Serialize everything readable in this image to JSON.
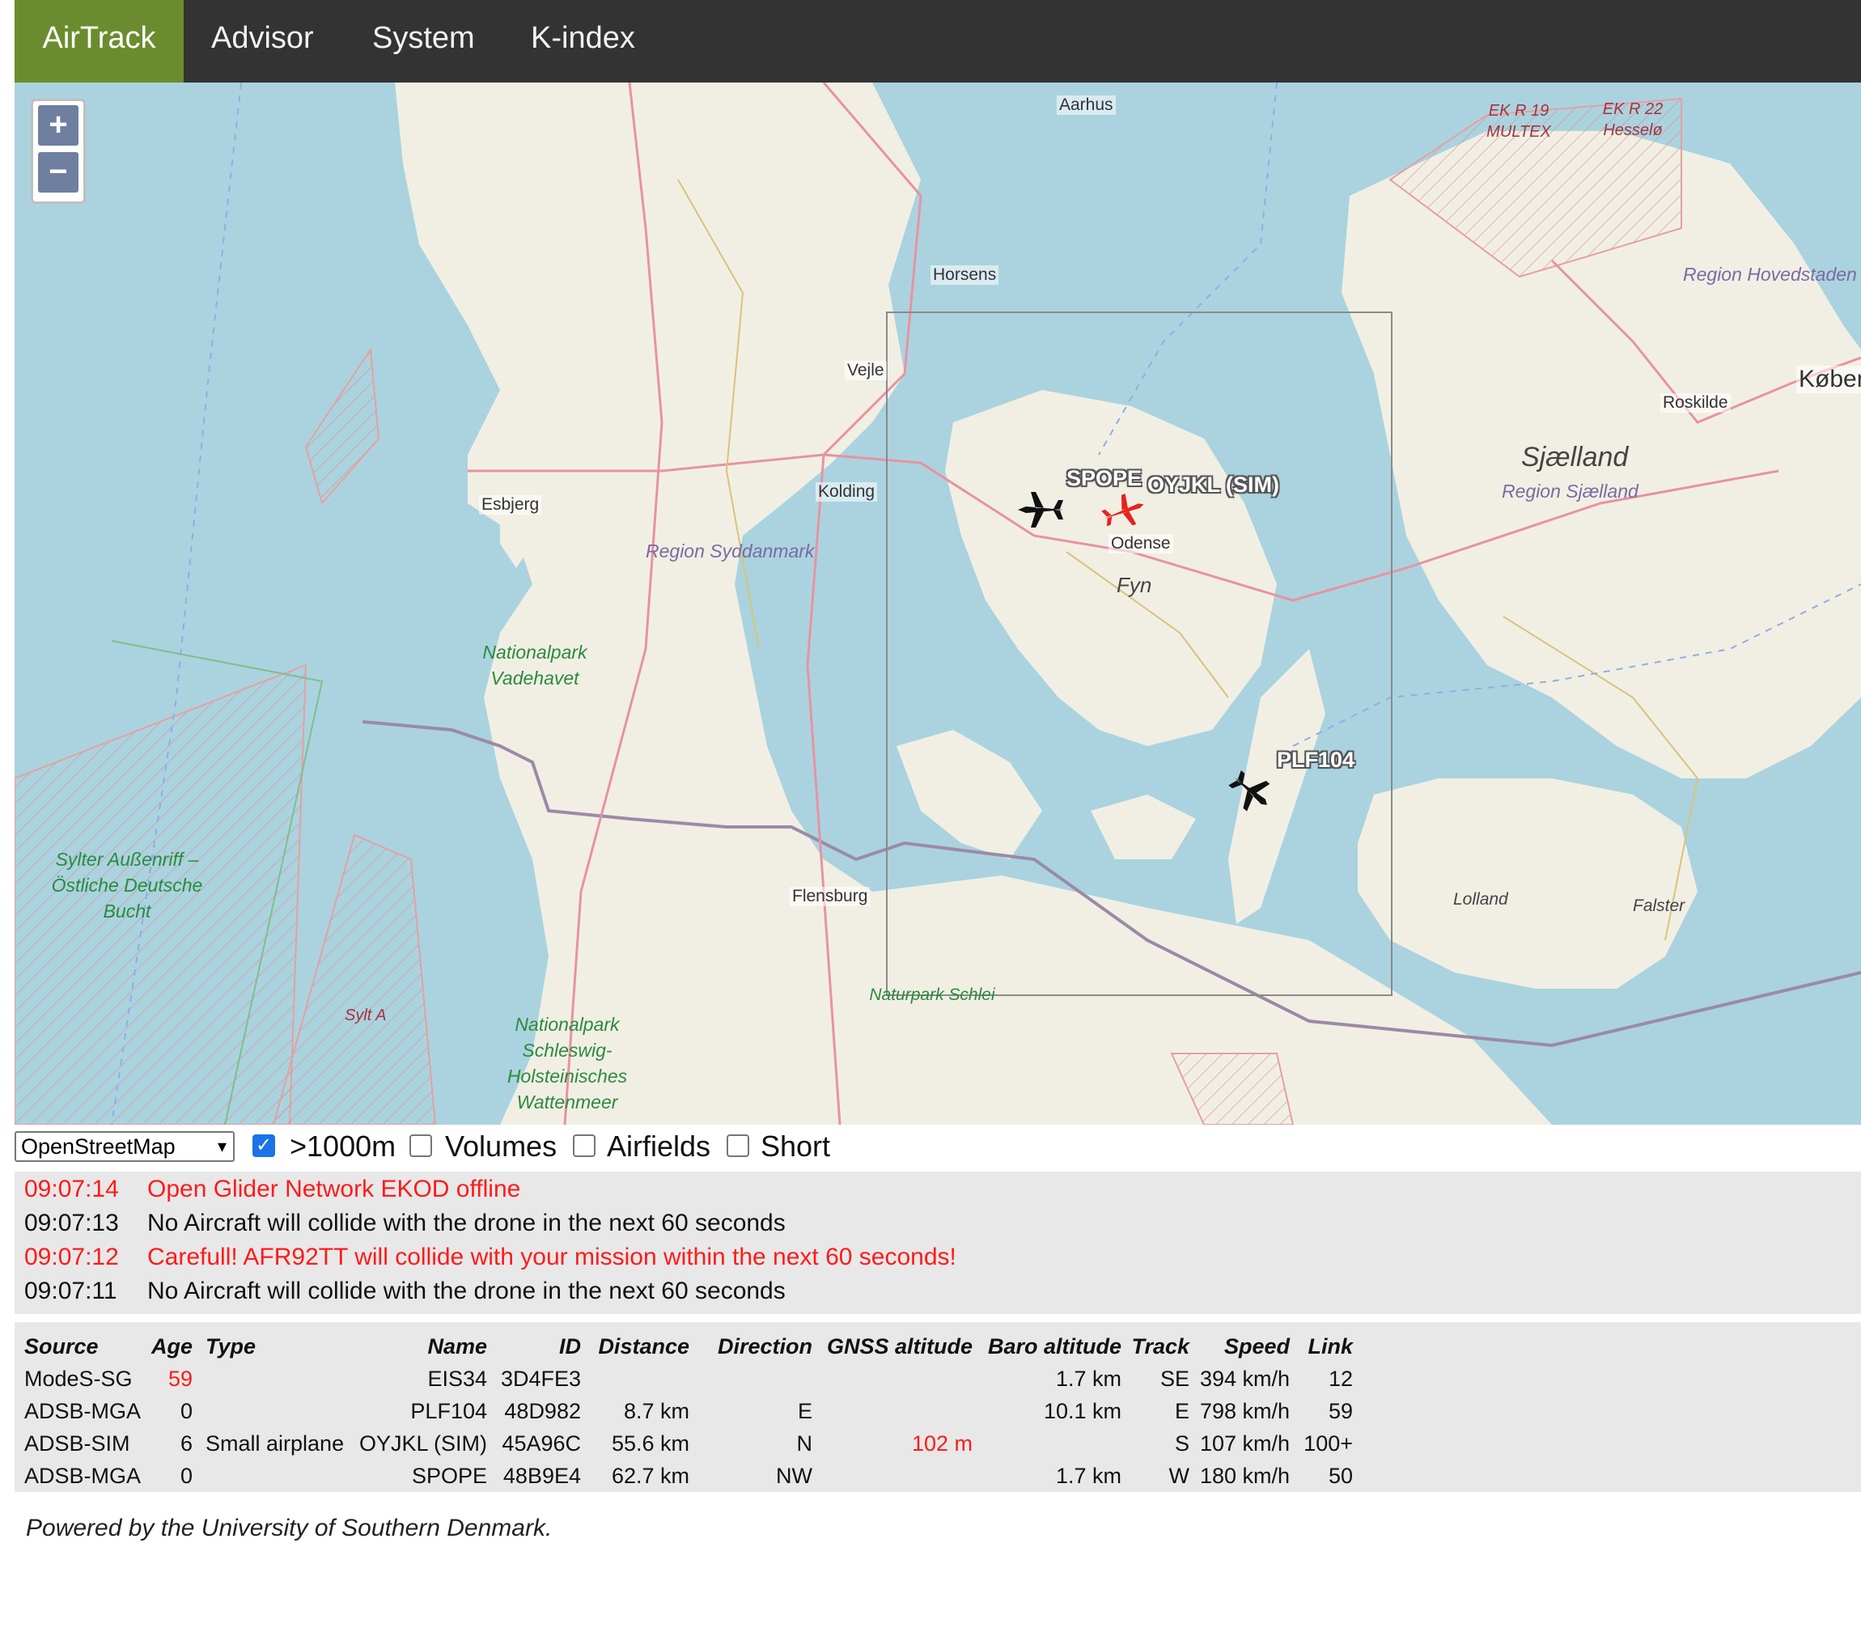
{
  "nav": {
    "items": [
      "AirTrack",
      "Advisor",
      "System",
      "K-index"
    ]
  },
  "map": {
    "zoom_in": "+",
    "zoom_out": "−",
    "labels": {
      "aarhus": "Aarhus",
      "horsens": "Horsens",
      "vejle": "Vejle",
      "kolding": "Kolding",
      "esbjerg": "Esbjerg",
      "odense": "Odense",
      "fyn": "Fyn",
      "flensburg": "Flensburg",
      "roskilde": "Roskilde",
      "kobenhavn": "Køben",
      "sjaelland": "Sjælland",
      "region_sjaelland": "Region Sjælland",
      "region_hovedstaden": "Region Hovedstaden",
      "region_syddanmark": "Region Syddanmark",
      "lolland": "Lolland",
      "falster": "Falster",
      "np_vadehavet": "Nationalpark Vadehavet",
      "sylter": "Sylter Außenriff – Östliche Deutsche Bucht",
      "sylt_a": "Sylt A",
      "np_schleswig": "Nationalpark Schleswig-Holsteinisches Wattenmeer",
      "naturpark_schlei": "Naturpark Schlei",
      "ekr19": "EK R 19 MULTEX",
      "ekr22": "EK R 22 Hesselø"
    },
    "aircraft_labels": {
      "spope": "SPOPE",
      "oyjkl": "OYJKL (SIM)",
      "plf104": "PLF104"
    },
    "colors": {
      "water": "#aad3df",
      "land": "#f1efe4",
      "sim_aircraft": "#e8211b",
      "aircraft": "#111111"
    }
  },
  "controls": {
    "layer_select": "OpenStreetMap",
    "filters": [
      {
        "label": ">1000m",
        "checked": true
      },
      {
        "label": "Volumes",
        "checked": false
      },
      {
        "label": "Airfields",
        "checked": false
      },
      {
        "label": "Short",
        "checked": false
      }
    ]
  },
  "log": [
    {
      "time": "09:07:14",
      "message": "Open Glider Network EKOD offline",
      "alert": true
    },
    {
      "time": "09:07:13",
      "message": "No Aircraft will collide with the drone in the next 60 seconds",
      "alert": false
    },
    {
      "time": "09:07:12",
      "message": "Carefull! AFR92TT will collide with your mission within the next 60 seconds!",
      "alert": true
    },
    {
      "time": "09:07:11",
      "message": "No Aircraft will collide with the drone in the next 60 seconds",
      "alert": false
    }
  ],
  "table": {
    "headers": [
      "Source",
      "Age",
      "Type",
      "Name",
      "ID",
      "Distance",
      "Direction",
      "GNSS altitude",
      "Baro altitude",
      "Track",
      "Speed",
      "Link"
    ],
    "rows": [
      [
        "ModeS-SG",
        "59",
        "",
        "EIS34",
        "3D4FE3",
        "",
        "",
        "",
        "1.7 km",
        "SE",
        "394 km/h",
        "12"
      ],
      [
        "ADSB-MGA",
        "0",
        "",
        "PLF104",
        "48D982",
        "8.7 km",
        "E",
        "",
        "10.1 km",
        "E",
        "798 km/h",
        "59"
      ],
      [
        "ADSB-SIM",
        "6",
        "Small airplane",
        "OYJKL (SIM)",
        "45A96C",
        "55.6 km",
        "N",
        "102 m",
        "",
        "S",
        "107 km/h",
        "100+"
      ],
      [
        "ADSB-MGA",
        "0",
        "",
        "SPOPE",
        "48B9E4",
        "62.7 km",
        "NW",
        "",
        "1.7 km",
        "W",
        "180 km/h",
        "50"
      ]
    ]
  },
  "footer": "Powered by the University of Southern Denmark."
}
